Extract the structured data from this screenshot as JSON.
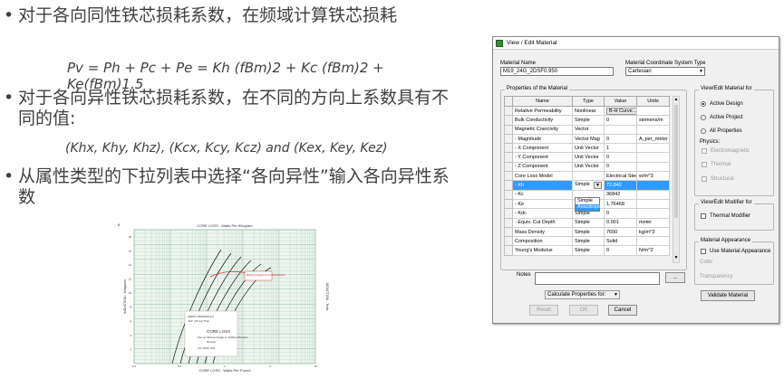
{
  "slide": {
    "bullet1": "对于各向同性铁芯损耗系数，在频域计算铁芯损耗",
    "formula1": "Pv = Ph + Pc + Pe = Kh (fBm)2 + Kc (fBm)2 + Ke(fBm)1.5",
    "bullet2": "对于各向异性铁芯损耗系数，在不同的方向上系数具有不同的值:",
    "formula2": "(Khx, Khy, Khz), (Kcx, Kcy, Kcz) and (Kex, Key, Kez)",
    "bullet3": "从属性类型的下拉列表中选择“各向异性”输入各向异性系数",
    "bullet_glyph": "•"
  },
  "chart": {
    "title": "CORE LOSS - Watts Per Kilogram",
    "xlabel": "CORE LOSS - Watts Per Pound",
    "ylabel_left": "INDUCTION - Kilogauss",
    "ylabel_right": "INDUCTION - Tesla",
    "note_red": "Watts Per Kilogram for 5 Rolling Direction",
    "caption_1": "ARMCO ORIENTED M-4",
    "caption_2": ".010\" (.25 mm) Thick",
    "caption_3": "CORE LOSS",
    "caption_4": "Flux at Various Angles to Rolling Direction",
    "caption_5": "60 Hertz",
    "caption_6": "Test: ORSA, 2000",
    "page_mark": "8",
    "x_ticks": [
      "0.1",
      "0.3",
      "1",
      "3",
      "10"
    ],
    "y_ticks": [
      "2",
      "4",
      "6",
      "8",
      "10",
      "12",
      "14",
      "16",
      "18"
    ],
    "colors": {
      "grid": "#8fbfa7",
      "paper": "#eef5ef",
      "curve": "#111111",
      "red": "#d42020"
    }
  },
  "dialog": {
    "title": "View / Edit Material",
    "material_name_label": "Material Name",
    "material_name_value": "M19_24G_2DSF0.950",
    "coord_label": "Material Coordinate System Type",
    "coord_value": "Cartesian",
    "props_group_title": "Properties of the Material",
    "columns": [
      "Name",
      "Type",
      "Value",
      "Units"
    ],
    "rows": [
      {
        "name": "Relative Permeability",
        "type": "Nonlinear",
        "value": "B-H Curve...",
        "units": "",
        "value_button": true
      },
      {
        "name": "Bulk Conductivity",
        "type": "Simple",
        "value": "0",
        "units": "siemens/m"
      },
      {
        "name": "Magnetic Coercivity",
        "type": "Vector",
        "value": "",
        "units": ""
      },
      {
        "name": "- Magnitude",
        "type": "Vector Mag",
        "value": "0",
        "units": "A_per_meter"
      },
      {
        "name": "- X Component",
        "type": "Unit Vector",
        "value": "1",
        "units": ""
      },
      {
        "name": "- Y Component",
        "type": "Unit Vector",
        "value": "0",
        "units": ""
      },
      {
        "name": "- Z Component",
        "type": "Unit Vector",
        "value": "0",
        "units": ""
      },
      {
        "name": "Core Loss Model",
        "type": "",
        "value": "Electrical Steel",
        "units": "w/m^3"
      },
      {
        "name": "- Kh",
        "type": "Simple",
        "value": "72.842",
        "units": "",
        "active": true
      },
      {
        "name": "- Kc",
        "type": "",
        "value": "36842",
        "units": ""
      },
      {
        "name": "- Ke",
        "type": "Simple",
        "value": "1.76468",
        "units": ""
      },
      {
        "name": "- Kdc",
        "type": "Simple",
        "value": "0",
        "units": ""
      },
      {
        "name": "- Equiv. Cut Depth",
        "type": "Simple",
        "value": "0.001",
        "units": "meter"
      },
      {
        "name": "Mass Density",
        "type": "Simple",
        "value": "7650",
        "units": "kg/m^3"
      },
      {
        "name": "Composition",
        "type": "Simple",
        "value": "Solid",
        "units": ""
      },
      {
        "name": "Young's Modulus",
        "type": "Simple",
        "value": "0",
        "units": "N/m^2"
      }
    ],
    "dropdown_options": [
      "Simple",
      "Anisotropic"
    ],
    "view_group_title": "View/Edit Material for",
    "view_options": [
      "Active Design",
      "Active Project",
      "All Properties"
    ],
    "physics_label": "Physics:",
    "physics_options": [
      "Electromagnetic",
      "Thermal",
      "Structural"
    ],
    "modifier_group_title": "View/Edit Modifier for",
    "modifier_option": "Thermal Modifier",
    "appearance_group_title": "Material Appearance",
    "appearance_option": "Use Material Appearance",
    "color_label": "Color",
    "transparency_label": "Transparency",
    "notes_label": "Notes",
    "notes_button": "...",
    "calc_label": "Calculate Properties for:",
    "validate_label": "Validate Material",
    "reset_label": "Reset",
    "ok_label": "OK",
    "cancel_label": "Cancel",
    "down_arrow": "▼",
    "up_arrow": "▲"
  }
}
